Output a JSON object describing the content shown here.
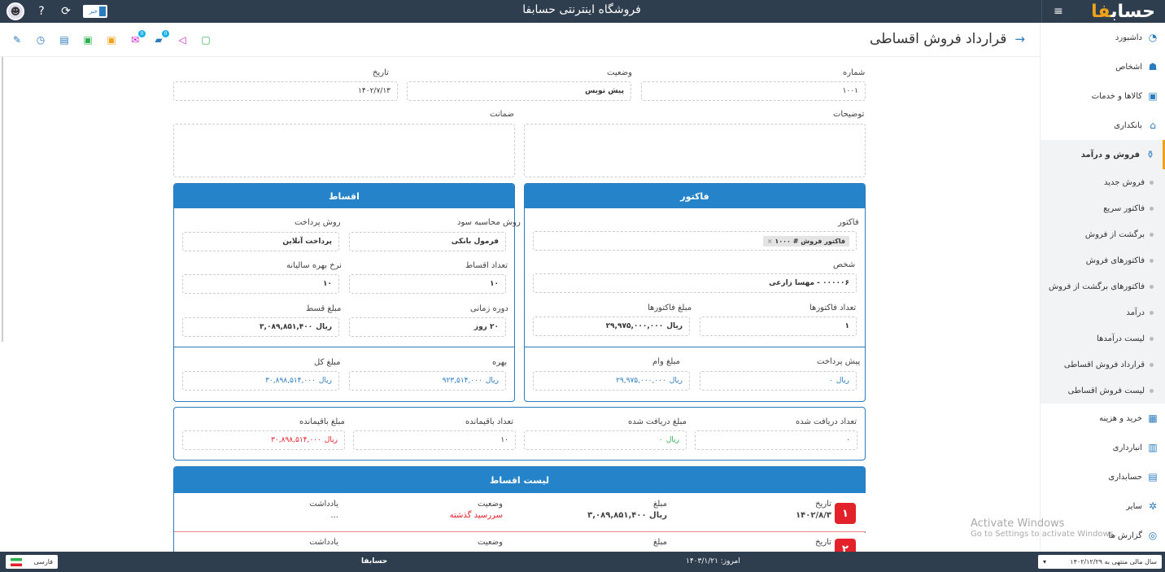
{
  "app": {
    "title": "فروشگاه اینترنتی حسابفا",
    "logo": "حساب",
    "logo_accent": "فا",
    "news_label": "خبر"
  },
  "colors": {
    "accent": "#2483c9",
    "brand": "#f0a21b",
    "danger": "#e2212b",
    "success": "#2bb24c",
    "dark": "#2f3e4e"
  },
  "toolbar_icons": [
    "pencil-icon",
    "clock-icon",
    "print-icon",
    "excel-icon",
    "pdf-export-icon",
    "sms-icon",
    "chat-icon",
    "send-icon",
    "share-icon"
  ],
  "toolbar_badges": {
    "sms": "0",
    "chat": "0"
  },
  "page": {
    "title": "قرارداد فروش اقساطی"
  },
  "fields": {
    "number_label": "شماره",
    "number_value": "۱۰۰۱",
    "status_label": "وضعیت",
    "status_value": "پیش نویس",
    "date_label": "تاریخ",
    "date_value": "۱۴۰۲/۷/۱۳",
    "desc_label": "توضیحات",
    "guarantee_label": "ضمانت"
  },
  "invoice_panel": {
    "title": "فاکتور",
    "invoice_label": "فاکتور",
    "invoice_tag": "فاکتور فروش # ۱۰۰۰",
    "person_label": "شخص",
    "person_value": "۰۰۰۰۰۶ - مهسا زارعی",
    "count_label": "تعداد فاکتورها",
    "count_value": "۱",
    "sum_label": "مبلغ فاکتورها",
    "sum_value": "۲۹,۹۷۵,۰۰۰,۰۰۰",
    "prepay_label": "پیش پرداخت",
    "prepay_value": "۰",
    "loan_label": "مبلغ وام",
    "loan_value": "۲۹,۹۷۵,۰۰۰,۰۰۰",
    "currency": "ریال"
  },
  "installment_panel": {
    "title": "اقساط",
    "calc_label": "روش محاسبه سود",
    "calc_value": "فرمول بانکی",
    "pay_label": "روش پرداخت",
    "pay_value": "پرداخت آنلاین",
    "count_label": "تعداد اقساط",
    "count_value": "۱۰",
    "rate_label": "نرخ بهره سالیانه",
    "rate_value": "۱۰",
    "period_label": "دوره زمانی",
    "period_value": "۲۰ روز",
    "inst_amount_label": "مبلغ قسط",
    "inst_amount_value": "۳,۰۸۹,۸۵۱,۴۰۰",
    "interest_label": "بهره",
    "interest_value": "۹۲۳,۵۱۴,۰۰۰",
    "total_label": "مبلغ کل",
    "total_value": "۳۰,۸۹۸,۵۱۴,۰۰۰",
    "currency": "ریال"
  },
  "summary": {
    "received_count_label": "تعداد دریافت شده",
    "received_count_value": "۰",
    "received_amount_label": "مبلغ دریافت شده",
    "received_amount_value": "۰",
    "remaining_count_label": "تعداد باقیمانده",
    "remaining_count_value": "۱۰",
    "remaining_amount_label": "مبلغ باقیمانده",
    "remaining_amount_value": "۳۰,۸۹۸,۵۱۴,۰۰۰",
    "currency": "ریال"
  },
  "installments": {
    "title": "لیست اقساط",
    "rows": [
      {
        "index": "۱",
        "date_label": "تاریخ",
        "date": "۱۴۰۲/۸/۳",
        "amount_label": "مبلغ",
        "amount": "۳,۰۸۹,۸۵۱,۴۰۰",
        "currency": "ریال",
        "status_label": "وضعیت",
        "status": "سررسید گذشته",
        "note_label": "یادداشت",
        "note": "..."
      },
      {
        "index": "۲",
        "date_label": "تاریخ",
        "date": "",
        "amount_label": "مبلغ",
        "amount": "",
        "currency": "",
        "status_label": "وضعیت",
        "status": "",
        "note_label": "یادداشت",
        "note": ""
      }
    ]
  },
  "sidebar": {
    "items": [
      {
        "label": "داشبورد",
        "icon": "dashboard-icon"
      },
      {
        "label": "اشخاص",
        "icon": "people-icon"
      },
      {
        "label": "کالاها و خدمات",
        "icon": "box-icon"
      },
      {
        "label": "بانکداری",
        "icon": "bank-icon"
      },
      {
        "label": "فروش و درآمد",
        "icon": "sales-icon"
      }
    ],
    "sub": [
      "فروش جدید",
      "فاکتور سریع",
      "برگشت از فروش",
      "فاکتورهای فروش",
      "فاکتورهای برگشت از فروش",
      "درآمد",
      "لیست درآمدها",
      "قرارداد فروش اقساطی",
      "لیست فروش اقساطی"
    ],
    "items2": [
      {
        "label": "خرید و هزینه",
        "icon": "purchase-icon"
      },
      {
        "label": "انبارداری",
        "icon": "warehouse-icon"
      },
      {
        "label": "حسابداری",
        "icon": "accounting-icon"
      },
      {
        "label": "سایر",
        "icon": "other-icon"
      },
      {
        "label": "گزارش ها",
        "icon": "report-icon"
      }
    ]
  },
  "statusbar": {
    "fiscal": "سال مالی منتهی به ۱۴۰۲/۱۲/۲۹",
    "today": "امروز: ۱۴۰۳/۱/۲۱",
    "brand": "حسابفا",
    "language": "فارسی"
  },
  "watermark": {
    "line1": "Activate Windows",
    "line2": "Go to Settings to activate Windows."
  }
}
